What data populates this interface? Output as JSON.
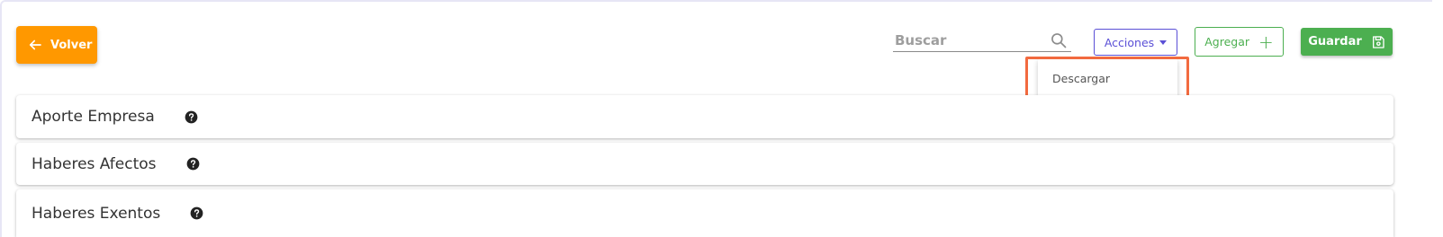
{
  "toolbar": {
    "back_label": "Volver",
    "search_placeholder": "Buscar",
    "actions_label": "Acciones",
    "add_label": "Agregar",
    "save_label": "Guardar"
  },
  "actions_menu": {
    "items": [
      {
        "label": "Descargar"
      }
    ]
  },
  "sections": [
    {
      "title": "Aporte Empresa"
    },
    {
      "title": "Haberes Afectos"
    },
    {
      "title": "Haberes Exentos"
    }
  ],
  "colors": {
    "back_button": "#ff9800",
    "actions_accent": "#5a4fd6",
    "add_accent": "#4caf50",
    "save_button": "#4caf50",
    "highlight": "#f26a3f"
  },
  "icons": {
    "back": "arrow-left-icon",
    "search": "search-icon",
    "actions_caret": "caret-down-icon",
    "add": "plus-icon",
    "save": "floppy-disk-icon",
    "help": "question-circle-icon"
  }
}
